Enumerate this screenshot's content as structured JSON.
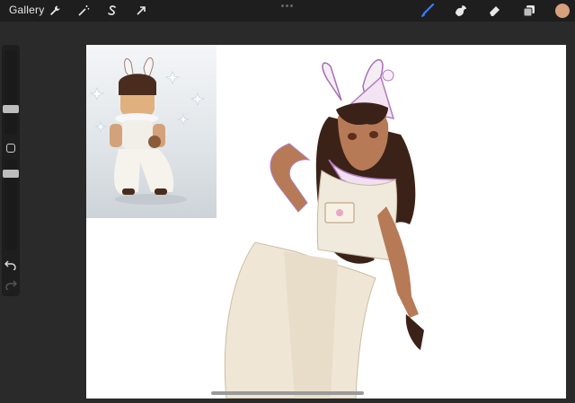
{
  "topbar": {
    "gallery_label": "Gallery",
    "left_tools": [
      "wrench-icon",
      "magic-wand-icon",
      "selection-icon",
      "transform-arrow-icon"
    ],
    "right_tools": [
      "brush-icon",
      "smudge-icon",
      "eraser-icon",
      "layers-icon"
    ]
  },
  "colors": {
    "active_tool": "#3b7dff",
    "current_color": "#d9a07c",
    "canvas": "#ffffff",
    "interface_dark": "#1e1e1e"
  },
  "sidebar": {
    "brush_size": 0.55,
    "opacity": 0.45,
    "buttons": [
      "undo-icon",
      "redo-icon"
    ]
  }
}
